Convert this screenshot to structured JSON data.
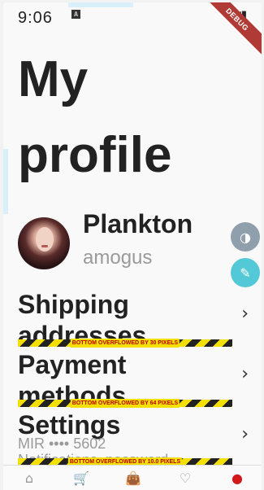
{
  "status": {
    "time": "9:06",
    "notif": "A",
    "system": "▾◢▮"
  },
  "debug_banner": "DEBUG",
  "title": "My profile",
  "profile": {
    "name": "Plankton",
    "handle": "amogus"
  },
  "rows": [
    {
      "label": "Shipping addresses",
      "overflow": "BOTTOM OVERFLOWED BY 30 PIXELS",
      "chevron": "›"
    },
    {
      "label": "Payment methods",
      "overflow": "BOTTOM OVERFLOWED BY 64 PIXELS",
      "chevron": "›",
      "sub": "MIR •••• 5602"
    },
    {
      "label": "Settings",
      "overflow": "BOTTOM OVERFLOWED BY 10.0 PIXELS",
      "chevron": "›",
      "sub": "Notifications, password"
    }
  ],
  "fab": {
    "theme_icon": "contrast-icon",
    "picker_icon": "eyedropper-icon"
  },
  "bottom_nav": [
    {
      "icon": "home-icon",
      "glyph": "⌂"
    },
    {
      "icon": "cart-icon",
      "glyph": "🛒"
    },
    {
      "icon": "bag-icon",
      "glyph": "👜"
    },
    {
      "icon": "heart-icon",
      "glyph": "♡"
    },
    {
      "icon": "profile-icon",
      "glyph": "●"
    }
  ]
}
